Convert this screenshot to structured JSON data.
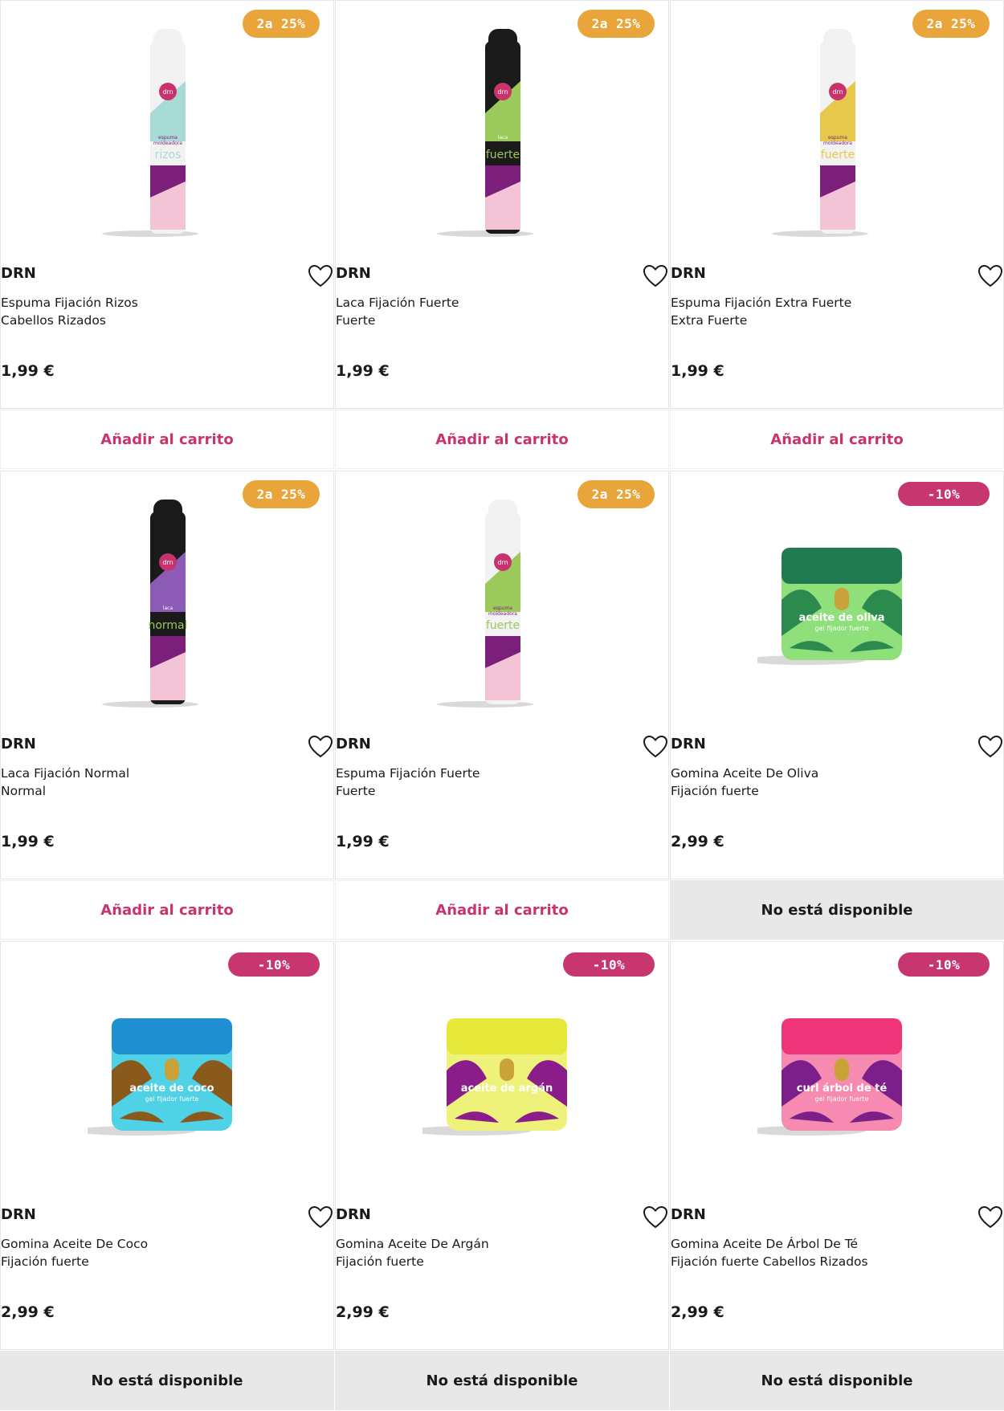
{
  "products": [
    {
      "brand": "DRN",
      "name1": "Espuma Fijación Rizos",
      "name2": "Cabellos Rizados",
      "price": "1,99 €",
      "badge": "2a 25%",
      "action": "Añadir al carrito",
      "can_top": "#f2f2f2",
      "mid": "#a8dad6",
      "low": "#7b1f7a",
      "base": "#f3c3d6",
      "label1": "espuma",
      "label2": "moldeadora",
      "label3": "rizos"
    },
    {
      "brand": "DRN",
      "name1": "Laca Fijación Fuerte",
      "name2": "Fuerte",
      "price": "1,99 €",
      "badge": "2a 25%",
      "action": "Añadir al carrito",
      "can_top": "#1a1a1a",
      "mid": "#9bc95a",
      "low": "#7b1f7a",
      "base": "#f3c3d6",
      "label1": "laca",
      "label2": "",
      "label3": "fuerte"
    },
    {
      "brand": "DRN",
      "name1": "Espuma Fijación Extra Fuerte",
      "name2": "Extra Fuerte",
      "price": "1,99 €",
      "badge": "2a 25%",
      "action": "Añadir al carrito",
      "can_top": "#f2f2f2",
      "mid": "#e8c84a",
      "low": "#7b1f7a",
      "base": "#f3c3d6",
      "label1": "espuma",
      "label2": "moldeadora",
      "label3": "fuerte"
    },
    {
      "brand": "DRN",
      "name1": "Laca Fijación Normal",
      "name2": "Normal",
      "price": "1,99 €",
      "badge": "2a 25%",
      "action": "Añadir al carrito",
      "can_top": "#1a1a1a",
      "mid": "#8b5bb5",
      "low": "#7b1f7a",
      "base": "#f3c3d6",
      "label1": "laca",
      "label2": "",
      "label3": "normal"
    },
    {
      "brand": "DRN",
      "name1": "Espuma Fijación Fuerte",
      "name2": "Fuerte",
      "price": "1,99 €",
      "badge": "2a 25%",
      "action": "Añadir al carrito",
      "can_top": "#f2f2f2",
      "mid": "#9bc95a",
      "low": "#7b1f7a",
      "base": "#f3c3d6",
      "label1": "espuma",
      "label2": "moldeadora",
      "label3": "fuerte"
    },
    {
      "brand": "DRN",
      "name1": "Gomina Aceite De Oliva",
      "name2": "Fijación fuerte",
      "price": "2,99 €",
      "badge": "-10%",
      "action": "No está disponible",
      "lid": "#1f7a52",
      "body": "#8fe07a",
      "accent": "#2d8a4e",
      "label3": "aceite de oliva",
      "label4": "gel fijador fuerte"
    },
    {
      "brand": "DRN",
      "name1": "Gomina Aceite De Coco",
      "name2": "Fijación fuerte",
      "price": "2,99 €",
      "badge": "-10%",
      "action": "No está disponible",
      "lid": "#1e8fd0",
      "body": "#4fd1e6",
      "accent": "#8a5a1c",
      "label3": "aceite de coco",
      "label4": "gel fijador fuerte"
    },
    {
      "brand": "DRN",
      "name1": "Gomina Aceite De Argán",
      "name2": "Fijación fuerte",
      "price": "2,99 €",
      "badge": "-10%",
      "action": "No está disponible",
      "lid": "#e6e83a",
      "body": "#eef27a",
      "accent": "#8a1d8a",
      "label3": "aceite de argán",
      "label4": ""
    },
    {
      "brand": "DRN",
      "name1": "Gomina Aceite De Árbol De Té",
      "name2": "Fijación fuerte Cabellos Rizados",
      "price": "2,99 €",
      "badge": "-10%",
      "action": "No está disponible",
      "lid": "#f0347a",
      "body": "#f78ab0",
      "accent": "#7b1f8a",
      "label3": "curl árbol de té",
      "label4": "gel fijador fuerte"
    }
  ],
  "logo_text": "drn",
  "icons": {
    "favorite": "heart-outline-icon"
  }
}
